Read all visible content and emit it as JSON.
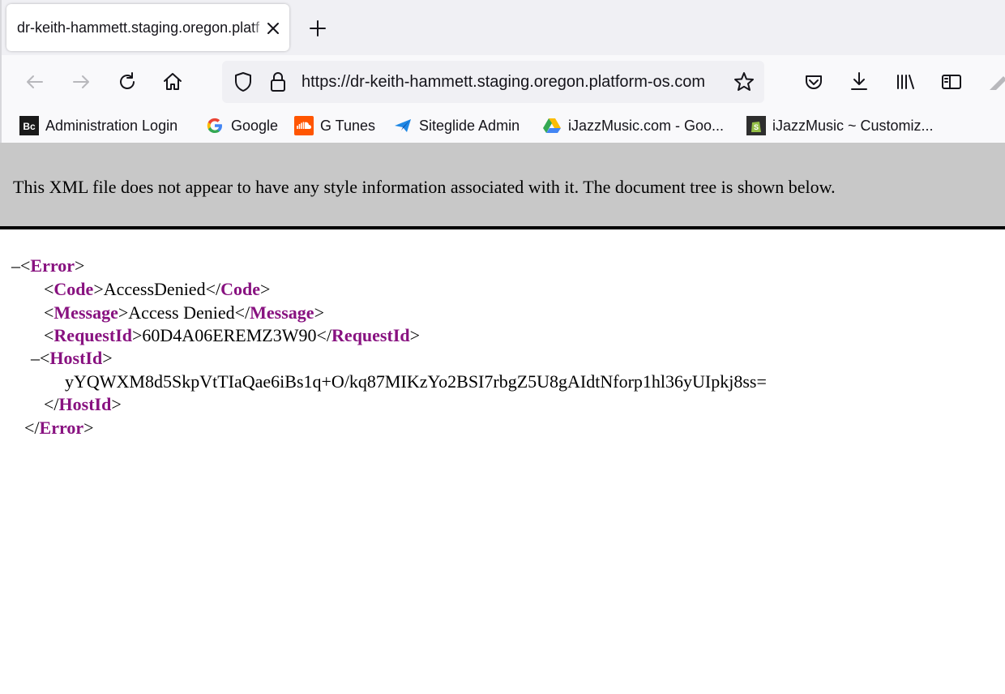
{
  "browser": {
    "tab": {
      "title": "dr-keith-hammett.staging.oregon.platform-os.com"
    },
    "url": "https://dr-keith-hammett.staging.oregon.platform-os.com",
    "bookmarks": [
      {
        "label": "Administration Login",
        "icon": "bc-logo-icon",
        "color": "#1a1a1a"
      },
      {
        "label": "Google",
        "icon": "google-logo-icon",
        "color": "#4285f4"
      },
      {
        "label": "G Tunes",
        "icon": "soundcloud-icon",
        "color": "#ff5500"
      },
      {
        "label": "Siteglide Admin",
        "icon": "paper-plane-icon",
        "color": "#1e88e5"
      },
      {
        "label": "iJazzMusic.com - Goo...",
        "icon": "google-drive-icon",
        "color": "#fbbc04"
      },
      {
        "label": "iJazzMusic ~ Customiz...",
        "icon": "shopify-icon",
        "color": "#2e2e2e"
      }
    ]
  },
  "xml_viewer": {
    "notice": "This XML file does not appear to have any style information associated with it. The document tree is shown below.",
    "toggle_glyph": "–",
    "lt": "<",
    "lt_close": "</",
    "gt": ">",
    "root_tag": "Error",
    "code": {
      "tag": "Code",
      "value": "AccessDenied"
    },
    "message": {
      "tag": "Message",
      "value": "Access Denied"
    },
    "request_id": {
      "tag": "RequestId",
      "value": "60D4A06EREMZ3W90"
    },
    "host_id": {
      "tag": "HostId",
      "value": "yYQWXM8d5SkpVtTIaQae6iBs1q+O/kq87MIKzYo2BSI7rbgZ5U8gAIdtNforp1hl36yUIpkj8ss="
    }
  },
  "colors": {
    "tag": "#881280",
    "banner": "#c8c8c8"
  }
}
